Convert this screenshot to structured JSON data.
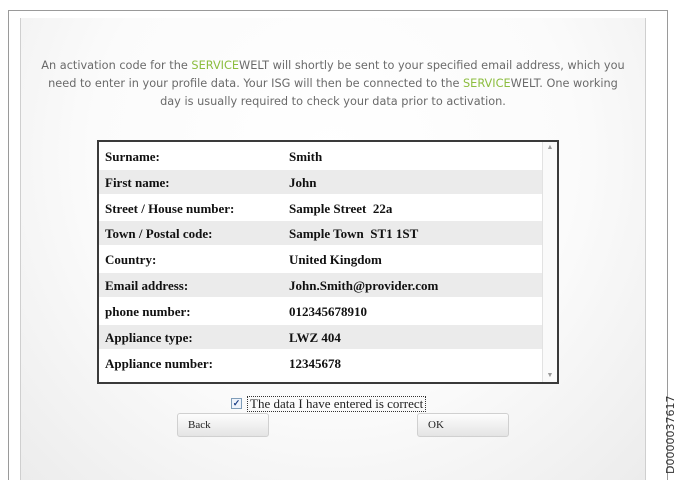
{
  "intro": {
    "line1_pre": "An activation code for the ",
    "brand1_part1": "SERVICE",
    "brand1_part2": "WELT",
    "line1_post": " will shortly be sent to your specified email address, which you",
    "line2_pre": "need to enter in your profile data. Your ISG will then be connected to the ",
    "brand2_part1": "SERVICE",
    "brand2_part2": "WELT",
    "line2_post": ". One working",
    "line3": "day is usually required to check your data prior to activation."
  },
  "rows": [
    {
      "label": "Surname:",
      "value": "Smith"
    },
    {
      "label": "First name:",
      "value": "John"
    },
    {
      "label": "Street / House number:",
      "value": "Sample Street  22a"
    },
    {
      "label": "Town / Postal code:",
      "value": "Sample Town  ST1 1ST"
    },
    {
      "label": "Country:",
      "value": "United Kingdom"
    },
    {
      "label": "Email address:",
      "value": "John.Smith@provider.com"
    },
    {
      "label": "phone number:",
      "value": "012345678910"
    },
    {
      "label": "Appliance type:",
      "value": "LWZ 404"
    },
    {
      "label": "Appliance number:",
      "value": "12345678"
    }
  ],
  "confirm": {
    "checked": true,
    "label": "The data I have entered is correct"
  },
  "buttons": {
    "back": "Back",
    "ok": "OK"
  },
  "doc_id": "D0000037617",
  "colors": {
    "brand_green": "#8cbd3f",
    "alt_row": "#ebebeb"
  }
}
